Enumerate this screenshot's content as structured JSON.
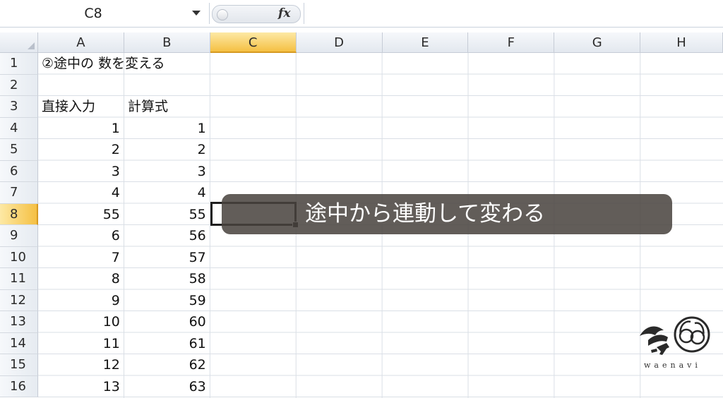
{
  "formula_bar": {
    "name_box": "C8",
    "fx_label": "fx",
    "formula": ""
  },
  "columns": [
    "A",
    "B",
    "C",
    "D",
    "E",
    "F",
    "G",
    "H"
  ],
  "active_column": "C",
  "rows": [
    "1",
    "2",
    "3",
    "4",
    "5",
    "6",
    "7",
    "8",
    "9",
    "10",
    "11",
    "12",
    "13",
    "14",
    "15",
    "16"
  ],
  "active_row": "8",
  "cells": {
    "title": "②途中の 数を変える",
    "header_a": "直接入力",
    "header_b": "計算式",
    "col_a": [
      "1",
      "2",
      "3",
      "4",
      "55",
      "6",
      "7",
      "8",
      "9",
      "10",
      "11",
      "12",
      "13"
    ],
    "col_b": [
      "1",
      "2",
      "3",
      "4",
      "55",
      "56",
      "57",
      "58",
      "59",
      "60",
      "61",
      "62",
      "63"
    ]
  },
  "caption": "途中から連動して変わる",
  "logo": {
    "text": "waenavi",
    "mark": "56"
  },
  "colors": {
    "active_header": "#f5c043",
    "caption_bg": "#48423e",
    "grid_line": "#dadfe6"
  }
}
